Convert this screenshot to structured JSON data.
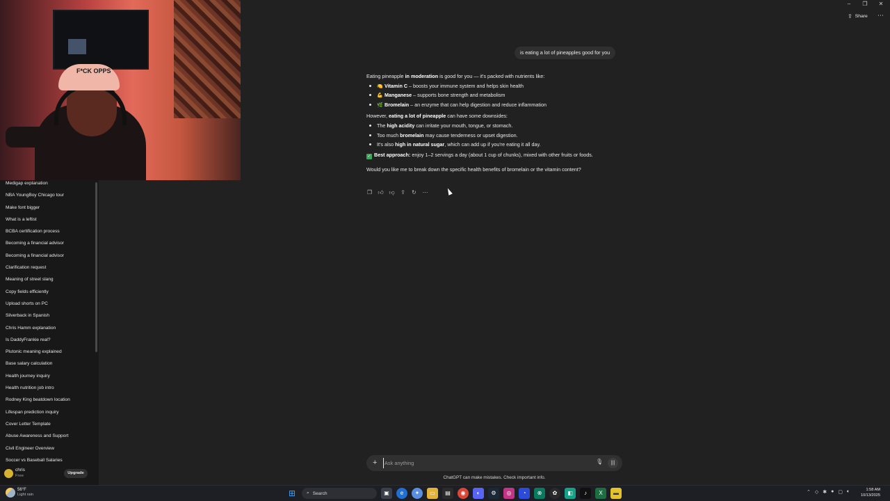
{
  "sidebar": {
    "history": [
      "Medigap explanation",
      "NBA YoungBoy Chicago tour",
      "Make font bigger",
      "What is a leftist",
      "BCBA certification process",
      "Becoming a financial advisor",
      "Becoming a financial advisor",
      "Clarification request",
      "Meaning of street slang",
      "Copy fields efficiently",
      "Upload shorts on PC",
      "Silverback in Spanish",
      "Chris Hamm explanation",
      "Is DaddyFrankie real?",
      "Plutonic meaning explained",
      "Base salary calculation",
      "Health journey inquiry",
      "Health nutrition job intro",
      "Rodney King beatdown location",
      "Lifespan prediction inquiry",
      "Cover Letter Template",
      "Abuse Awareness and Support",
      "Civil Engineer Overview",
      "Soccer vs Baseball Salaries"
    ],
    "user": {
      "name": "chris",
      "plan": "Free",
      "upgrade_label": "Upgrade"
    }
  },
  "webcam": {
    "cap_text": "F*CK OPPS"
  },
  "header": {
    "share_label": "Share"
  },
  "conversation": {
    "user_message": "is eating a lot of pineapples good for you",
    "assistant": {
      "intro_pre": "Eating pineapple ",
      "intro_bold": "in moderation",
      "intro_post": " is good for you — it's packed with nutrients like:",
      "benefits": [
        {
          "emoji": "🍋",
          "title": "Vitamin C",
          "text": " – boosts your immune system and helps skin health"
        },
        {
          "emoji": "💪",
          "title": "Manganese",
          "text": " – supports bone strength and metabolism"
        },
        {
          "emoji": "🌿",
          "title": "Bromelain",
          "text": " – an enzyme that can help digestion and reduce inflammation"
        }
      ],
      "however_pre": "However, ",
      "however_bold": "eating a lot of pineapple",
      "however_post": " can have some downsides:",
      "downsides": [
        {
          "pre": "The ",
          "bold": "high acidity",
          "post": " can irritate your mouth, tongue, or stomach."
        },
        {
          "pre": "Too much ",
          "bold": "bromelain",
          "post": " may cause tenderness or upset digestion."
        },
        {
          "pre": "It's also ",
          "bold": "high in natural sugar",
          "post": ", which can add up if you're eating it all day."
        }
      ],
      "best_bold": "Best approach:",
      "best_text": " enjoy 1–2 servings a day (about 1 cup of chunks), mixed with other fruits or foods.",
      "followup": "Would you like me to break down the specific health benefits of bromelain or the vitamin content?"
    }
  },
  "composer": {
    "placeholder": "Ask anything",
    "disclaimer": "ChatGPT can make mistakes. Check important info."
  },
  "taskbar": {
    "weather_temp": "56°F",
    "weather_desc": "Light rain",
    "search_label": "Search",
    "time": "1:58 AM",
    "date": "10/13/2025"
  },
  "colors": {
    "background": "#212121",
    "sidebar": "#181818",
    "bubble": "#2f2f2f",
    "accent_check": "#3ca65b"
  }
}
